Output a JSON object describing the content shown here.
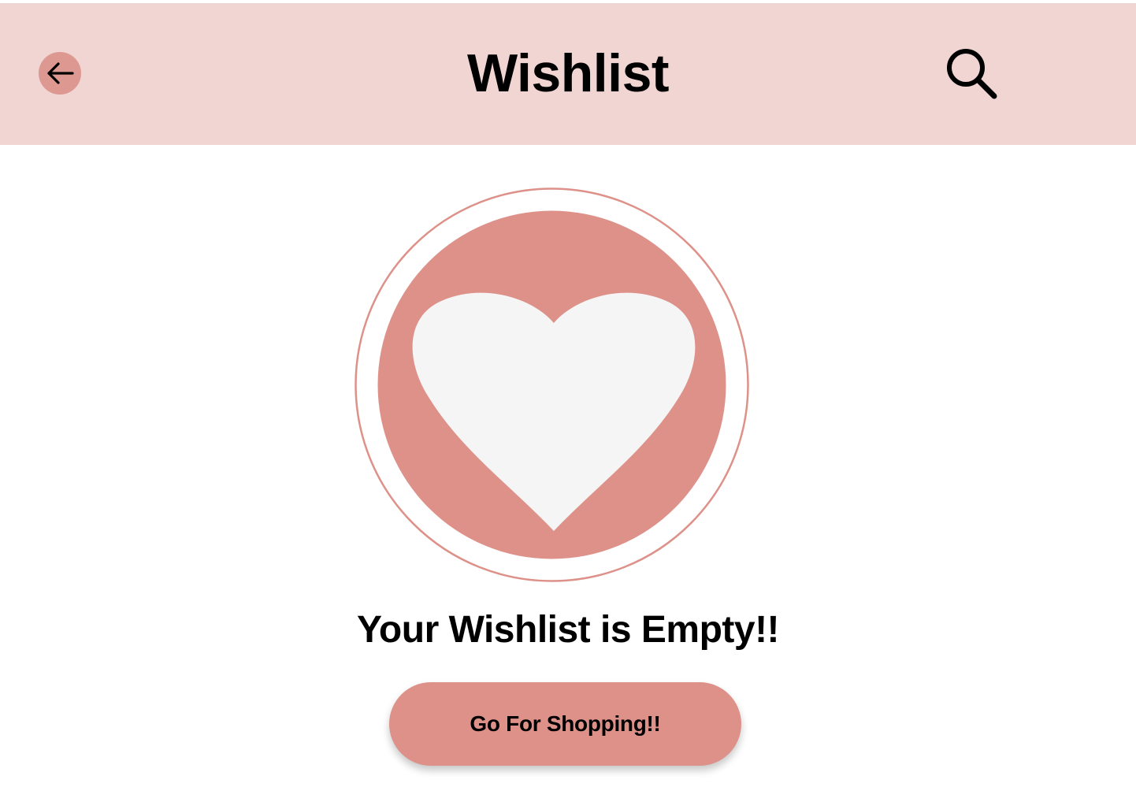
{
  "header": {
    "title": "Wishlist",
    "back_icon": "arrow-left-icon",
    "search_icon": "search-icon"
  },
  "empty_state": {
    "illustration_icon": "heart-icon",
    "message": "Your Wishlist is Empty!!",
    "cta_label": "Go For Shopping!!"
  },
  "colors": {
    "header_bg": "#f1d5d2",
    "accent": "#dd9189",
    "heart": "#f5f5f5"
  }
}
